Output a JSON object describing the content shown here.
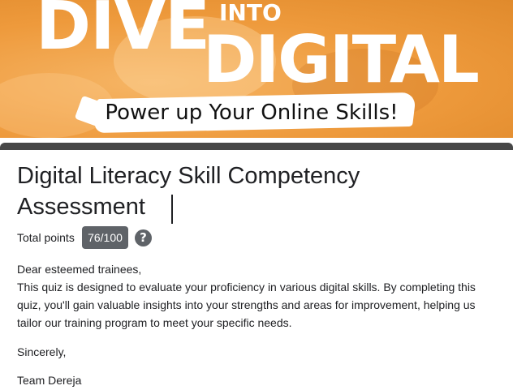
{
  "banner": {
    "word1": "DIVE",
    "word2": "INTO",
    "word3": "DIGITAL",
    "tagline": "Power up Your Online Skills!"
  },
  "form": {
    "title": "Digital Literacy Skill Competency Assessment",
    "points_label": "Total points",
    "points_value": "76/100",
    "help_glyph": "?"
  },
  "description": {
    "greeting": "Dear esteemed trainees,",
    "body": "This quiz is designed to evaluate your proficiency in various digital skills. By completing this quiz, you'll gain valuable insights into your strengths and areas for improvement, helping us tailor our training program to meet your specific needs.",
    "closing": "Sincerely,",
    "signature": "Team Dereja"
  },
  "colors": {
    "banner_orange": "#ee9a3c",
    "header_bar": "#474747",
    "badge": "#5f6368",
    "text": "#202124"
  }
}
